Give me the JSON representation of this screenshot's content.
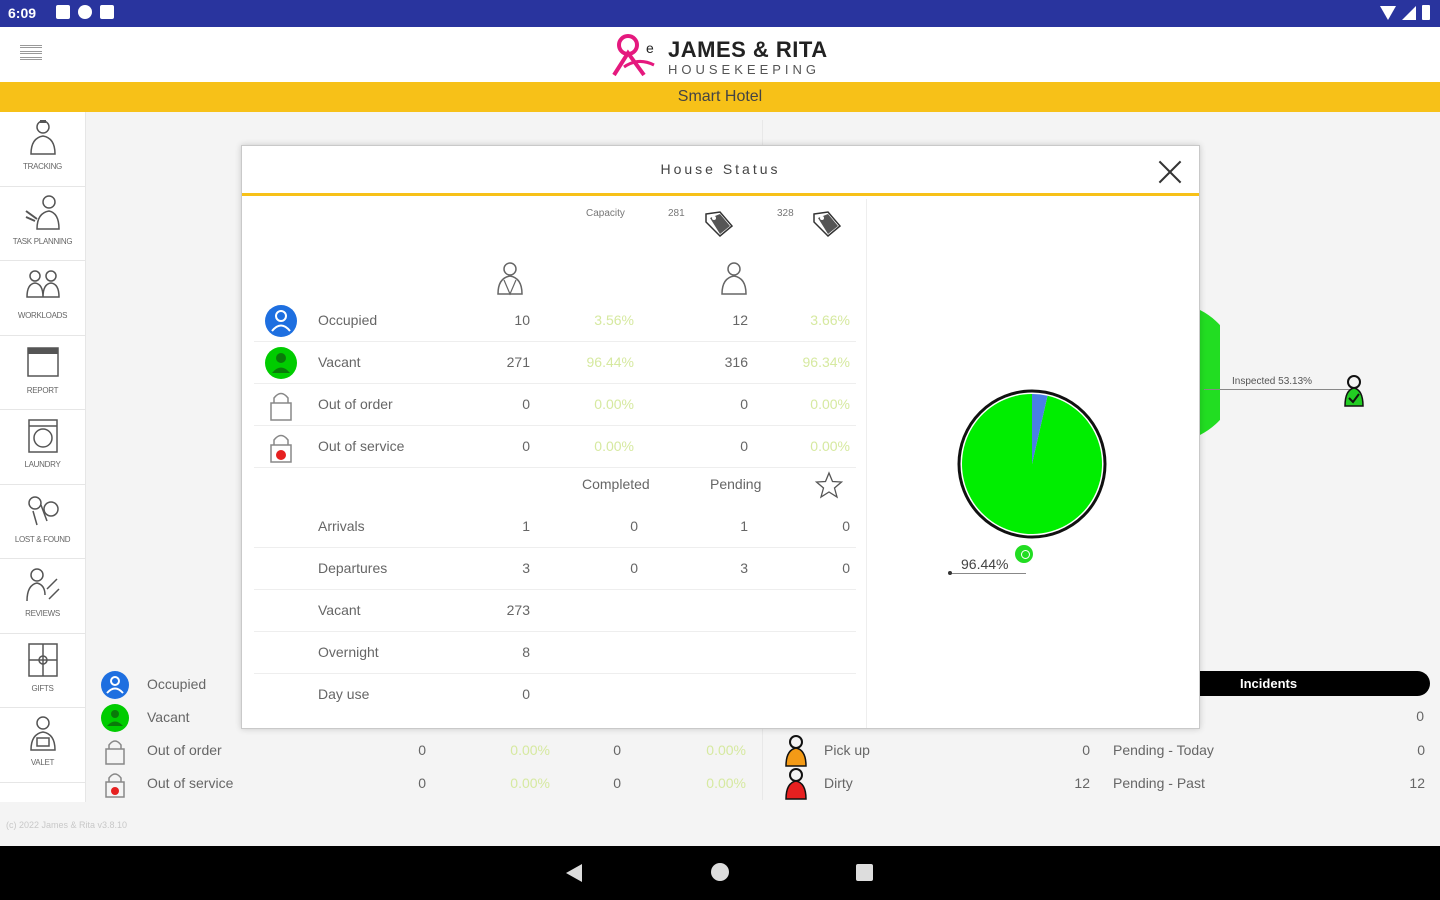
{
  "status_bar": {
    "time": "6:09"
  },
  "header": {
    "brand": "JAMES & RITA",
    "brand_sub": "HOUSEKEEPING",
    "hotel_name": "Smart Hotel"
  },
  "sidebar": {
    "items": [
      {
        "label": "TRACKING"
      },
      {
        "label": "TASK PLANNING"
      },
      {
        "label": "WORKLOADS"
      },
      {
        "label": "REPORT"
      },
      {
        "label": "LAUNDRY"
      },
      {
        "label": "LOST & FOUND"
      },
      {
        "label": "REVIEWS"
      },
      {
        "label": "GIFTS"
      },
      {
        "label": "VALET"
      }
    ]
  },
  "footer": {
    "copyright": "(c) 2022 James & Rita v3.8.10"
  },
  "background": {
    "legend": [
      {
        "name": "Occupied",
        "v1": "",
        "p1": "",
        "v2": "",
        "p2": ""
      },
      {
        "name": "Vacant",
        "v1": "",
        "p1": "",
        "v2": "",
        "p2": ""
      },
      {
        "name": "Out of order",
        "v1": "0",
        "p1": "0.00%",
        "v2": "0",
        "p2": "0.00%"
      },
      {
        "name": "Out of service",
        "v1": "0",
        "p1": "0.00%",
        "v2": "0",
        "p2": "0.00%"
      }
    ],
    "right_rows": [
      {
        "name": "Pick up",
        "count": "0",
        "name2": "Pending - Today",
        "count2": "0"
      },
      {
        "name": "Dirty",
        "count": "12",
        "name2": "Pending - Past",
        "count2": "12"
      }
    ],
    "incidents_label": "Incidents",
    "incidents_first_value": "0",
    "inspected_label": "Inspected 53.13%"
  },
  "modal": {
    "title": "House Status",
    "capacity_label": "Capacity",
    "capacity_1": "281",
    "capacity_2": "328",
    "status_rows": [
      {
        "name": "Occupied",
        "a": "10",
        "ap": "3.56%",
        "b": "12",
        "bp": "3.66%"
      },
      {
        "name": "Vacant",
        "a": "271",
        "ap": "96.44%",
        "b": "316",
        "bp": "96.34%"
      },
      {
        "name": "Out of order",
        "a": "0",
        "ap": "0.00%",
        "b": "0",
        "bp": "0.00%"
      },
      {
        "name": "Out of service",
        "a": "0",
        "ap": "0.00%",
        "b": "0",
        "bp": "0.00%"
      }
    ],
    "sub_headers": {
      "completed": "Completed",
      "pending": "Pending"
    },
    "movement_rows": [
      {
        "name": "Arrivals",
        "a": "1",
        "c": "0",
        "b": "1",
        "d": "0"
      },
      {
        "name": "Departures",
        "a": "3",
        "c": "0",
        "b": "3",
        "d": "0"
      },
      {
        "name": "Vacant",
        "a": "273",
        "c": "",
        "b": "",
        "d": ""
      },
      {
        "name": "Overnight",
        "a": "8",
        "c": "",
        "b": "",
        "d": ""
      },
      {
        "name": "Day use",
        "a": "0",
        "c": "",
        "b": "",
        "d": ""
      }
    ],
    "pie": {
      "label": "96.44%",
      "slices": [
        {
          "name": "Vacant",
          "value": 96.44,
          "color": "#00ee00"
        },
        {
          "name": "Occupied",
          "value": 3.56,
          "color": "#4a7fe6"
        }
      ]
    }
  },
  "colors": {
    "accent": "#f7c118",
    "status_bar": "#29349e",
    "occupied": "#1e6fe0",
    "vacant": "#00cc00",
    "pickup": "#f39a16",
    "dirty": "#e62020"
  }
}
